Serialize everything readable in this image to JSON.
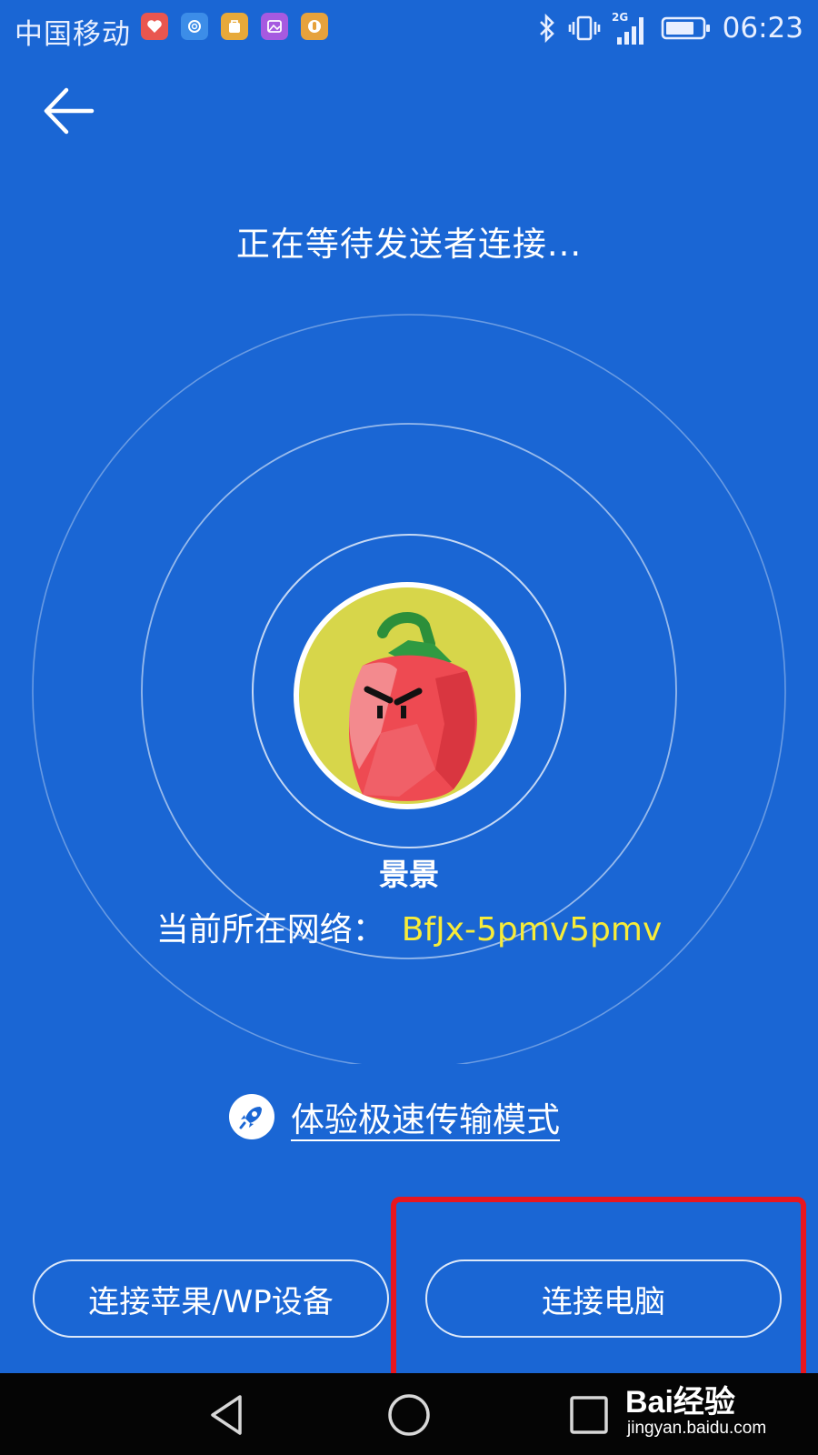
{
  "status_bar": {
    "carrier": "中国移动",
    "network_type": "2G",
    "time": "06:23",
    "notification_icons": [
      "health-app-icon",
      "swirl-app-icon",
      "store-app-icon",
      "gallery-app-icon",
      "hand-app-icon"
    ],
    "system_icons": [
      "bluetooth-icon",
      "vibrate-icon",
      "signal-icon",
      "battery-icon"
    ]
  },
  "header": {
    "back_icon": "arrow-left-icon",
    "title": "正在等待发送者连接..."
  },
  "profile": {
    "avatar": "chili-pepper-avatar",
    "name": "景景",
    "network_label": "当前所在网络：",
    "network_name": "BfJx-5pmv5pmv"
  },
  "turbo": {
    "icon": "rocket-icon",
    "label": "体验极速传输模式"
  },
  "buttons": {
    "connect_apple": "连接苹果/WP设备",
    "connect_pc": "连接电脑"
  },
  "nav": {
    "back": "triangle-back-icon",
    "home": "circle-home-icon",
    "recent": "square-recent-icon"
  },
  "watermark": {
    "logo": "Bai经验",
    "site": "jingyan.baidu.com"
  },
  "colors": {
    "background": "#1a66d4",
    "network_highlight": "#f7ec39",
    "annotation_box": "#e8161f",
    "avatar_bg": "#d7d64a"
  }
}
